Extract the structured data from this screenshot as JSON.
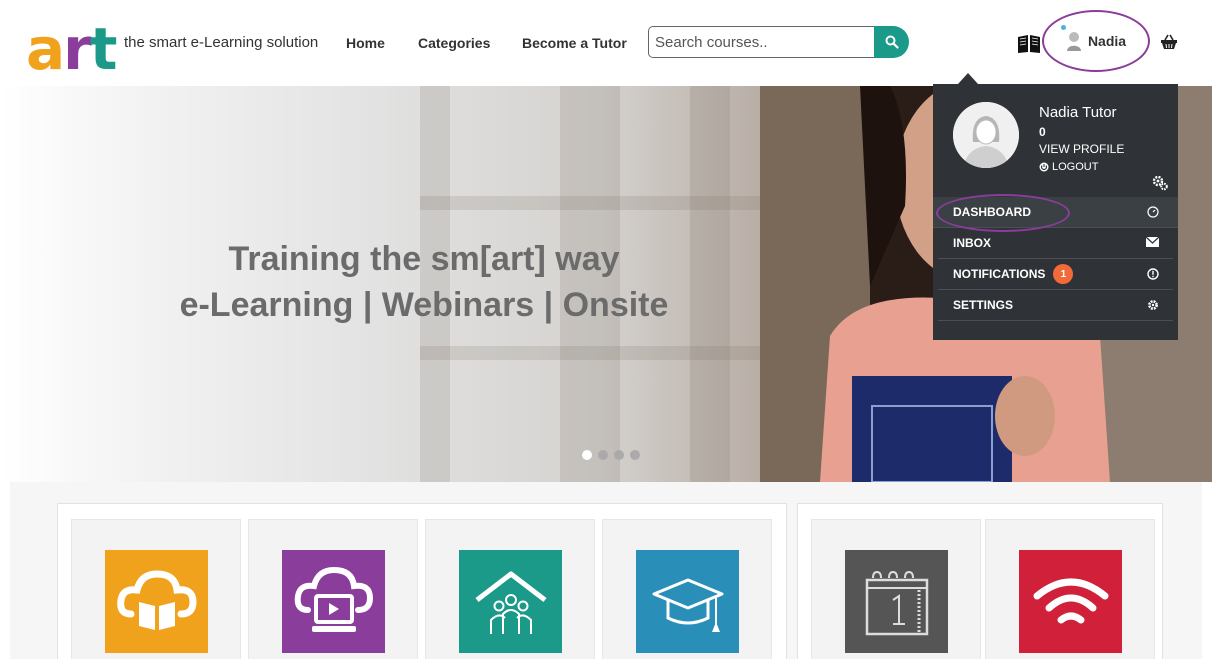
{
  "header": {
    "logo_text": "art",
    "tagline": "the smart e-Learning solution",
    "nav": [
      "Home",
      "Categories",
      "Become a Tutor"
    ],
    "search_placeholder": "Search courses..",
    "user_name": "Nadia"
  },
  "hero": {
    "headline_line1": "Training the sm[art] way",
    "headline_line2": "e-Learning | Webinars | Onsite",
    "slide_count": 4,
    "active_slide": 1
  },
  "dropdown": {
    "full_name": "Nadia Tutor",
    "count": "0",
    "view_profile": "VIEW PROFILE",
    "logout": "LOGOUT",
    "menu": [
      {
        "label": "DASHBOARD",
        "icon": "dashboard-icon"
      },
      {
        "label": "INBOX",
        "icon": "envelope-icon"
      },
      {
        "label": "NOTIFICATIONS",
        "icon": "alert-circle-icon",
        "badge": "1"
      },
      {
        "label": "SETTINGS",
        "icon": "gear-icon"
      }
    ]
  },
  "colors": {
    "accent": "#1b9a8a",
    "brand_orange": "#f0a21d",
    "brand_purple": "#8a3d9a",
    "dropdown_bg": "#2f3337",
    "badge": "#f26a3a",
    "tile_orange": "#f0a21d",
    "tile_purple": "#8a3d9a",
    "tile_teal": "#1b9a8a",
    "tile_blue": "#2a8fb8",
    "tile_gray": "#555555",
    "tile_red": "#d0203a"
  },
  "tiles": [
    "cloud-book-icon",
    "cloud-video-icon",
    "classroom-icon",
    "graduation-cap-icon",
    "calendar-icon",
    "wifi-icon"
  ]
}
